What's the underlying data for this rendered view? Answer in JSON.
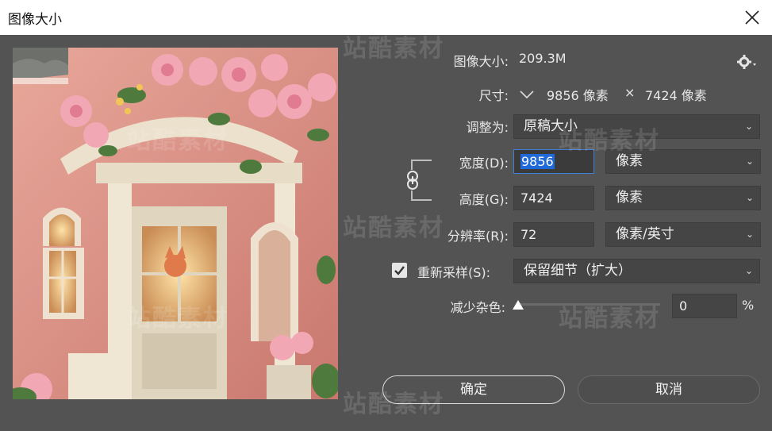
{
  "window": {
    "title": "图像大小"
  },
  "image_size": {
    "label": "图像大小:",
    "value": "209.3M"
  },
  "dimensions": {
    "label": "尺寸:",
    "width": "9856 像素",
    "separator": "×",
    "height": "7424 像素"
  },
  "fit_to": {
    "label": "调整为:",
    "value": "原稿大小"
  },
  "width": {
    "label": "宽度(D):",
    "value": "9856",
    "unit": "像素"
  },
  "height": {
    "label": "高度(G):",
    "value": "7424",
    "unit": "像素"
  },
  "resolution": {
    "label": "分辨率(R):",
    "value": "72",
    "unit": "像素/英寸"
  },
  "resample": {
    "label": "重新采样(S):",
    "checked": true,
    "method": "保留细节（扩大）"
  },
  "noise": {
    "label": "减少杂色:",
    "value": "0",
    "unit": "%"
  },
  "buttons": {
    "ok": "确定",
    "cancel": "取消"
  },
  "watermark": "站酷素材",
  "colors": {
    "dialog_bg": "#535353",
    "field_bg": "#454545",
    "focus": "#3f7fd6",
    "selection": "#1f6ad8"
  }
}
